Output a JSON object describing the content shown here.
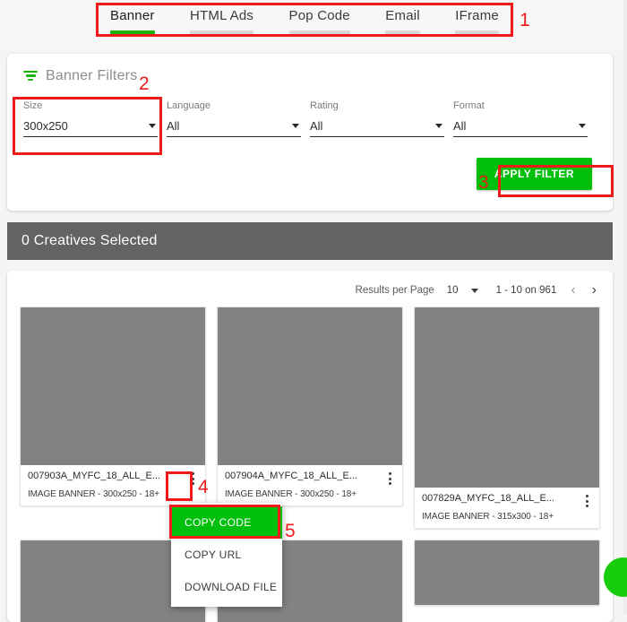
{
  "tabs": [
    {
      "label": "Banner",
      "active": true
    },
    {
      "label": "HTML Ads",
      "active": false
    },
    {
      "label": "Pop Code",
      "active": false
    },
    {
      "label": "Email",
      "active": false
    },
    {
      "label": "IFrame",
      "active": false
    }
  ],
  "filters": {
    "title": "Banner Filters",
    "icon": "filter-funnel-icon",
    "fields": [
      {
        "label": "Size",
        "value": "300x250"
      },
      {
        "label": "Language",
        "value": "All"
      },
      {
        "label": "Rating",
        "value": "All"
      },
      {
        "label": "Format",
        "value": "All"
      }
    ],
    "apply_label": "APPLY FILTER"
  },
  "selection": {
    "text": "0 Creatives Selected"
  },
  "results": {
    "results_per_page_label": "Results per Page",
    "results_per_page_value": "10",
    "range": "1 - 10 on 961",
    "prev_icon": "chevron-left-icon",
    "next_icon": "chevron-right-icon",
    "cards": [
      {
        "title": "007903A_MYFC_18_ALL_E...",
        "meta": "IMAGE BANNER - 300x250 - 18+",
        "thumb_h": 176
      },
      {
        "title": "007904A_MYFC_18_ALL_E...",
        "meta": "IMAGE BANNER - 300x250 - 18+",
        "thumb_h": 176
      },
      {
        "title": "007829A_MYFC_18_ALL_E...",
        "meta": "IMAGE BANNER - 315x300 - 18+",
        "thumb_h": 201
      }
    ],
    "row2_thumb_h": 90
  },
  "context_menu": {
    "items": [
      {
        "label": "COPY CODE",
        "highlighted": true
      },
      {
        "label": "COPY URL",
        "highlighted": false
      },
      {
        "label": "DOWNLOAD FILE",
        "highlighted": false
      }
    ]
  },
  "annotations": [
    {
      "num": "1"
    },
    {
      "num": "2"
    },
    {
      "num": "3"
    },
    {
      "num": "4"
    },
    {
      "num": "5"
    }
  ],
  "colors": {
    "accent_green": "#00bf0d",
    "annotation_red": "#ee1b1b",
    "bar_gray": "#636363"
  }
}
